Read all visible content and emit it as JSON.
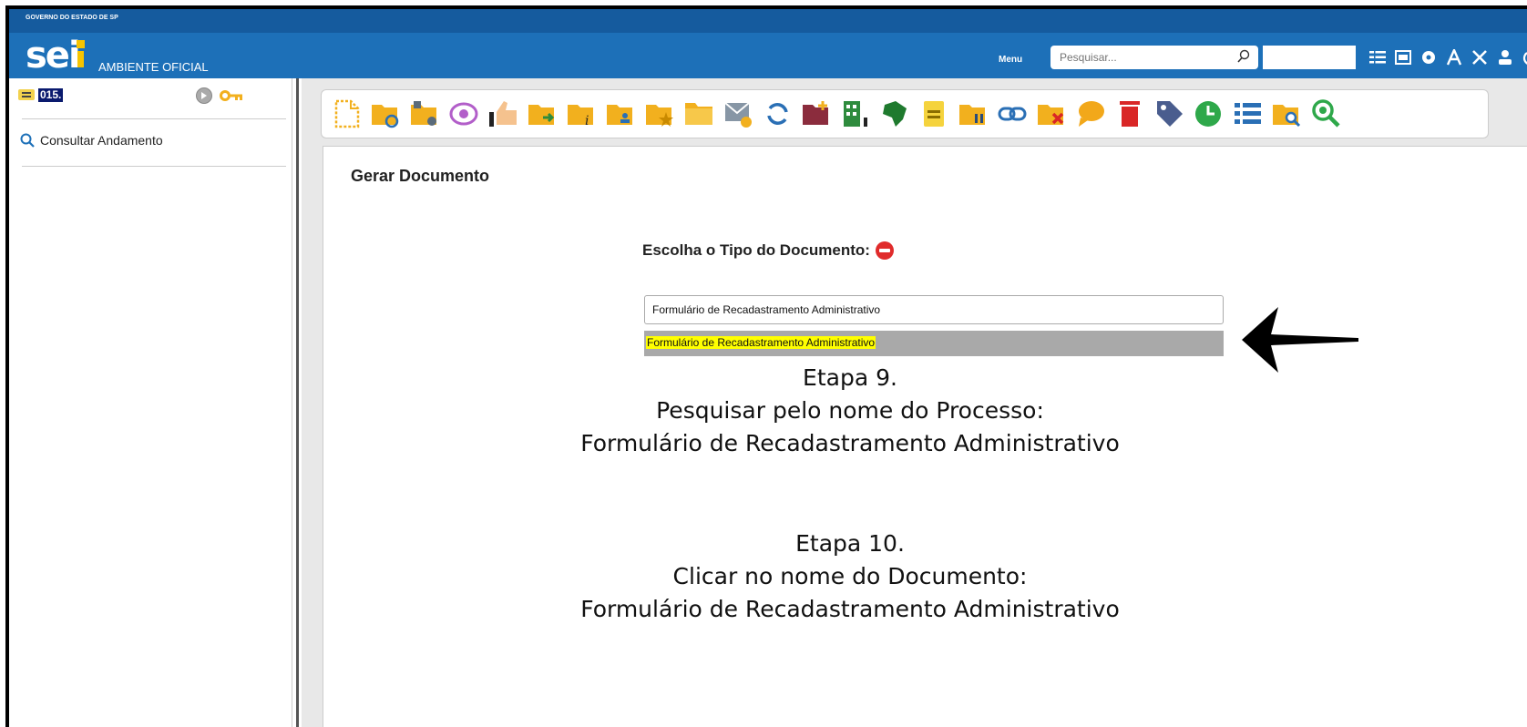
{
  "gov_bar": {
    "text": "GOVERNO DO ESTADO DE SP"
  },
  "header": {
    "logo_text": "sei",
    "ambiente": "AMBIENTE OFICIAL",
    "menu_label": "Menu",
    "search_placeholder": "Pesquisar..."
  },
  "sidebar": {
    "process_number": "015.",
    "consultar_label": "Consultar Andamento"
  },
  "main": {
    "title": "Gerar Documento",
    "escolha_label": "Escolha o Tipo do Documento:",
    "tipo_input_value": "Formulário de Recadastramento Administrativo",
    "suggestion": "Formulário de Recadastramento Administrativo",
    "etapa9": {
      "line1": "Etapa 9.",
      "line2": "Pesquisar pelo nome do Processo:",
      "line3": "Formulário de Recadastramento Administrativo"
    },
    "etapa10": {
      "line1": "Etapa 10.",
      "line2": "Clicar no nome do Documento:",
      "line3": "Formulário de Recadastramento Administrativo"
    }
  },
  "icons": {
    "toolbar": [
      "new-document-icon",
      "folder-sync-icon",
      "folder-settings-icon",
      "eye-icon",
      "thumbs-up-icon",
      "folder-send-icon",
      "folder-info-icon",
      "folder-user-icon",
      "folder-star-icon",
      "folder-icon",
      "mail-icon",
      "refresh-icon",
      "folder-add-icon",
      "building-icon",
      "brazil-map-icon",
      "note-icon",
      "folder-pause-icon",
      "link-icon",
      "folder-delete-icon",
      "comment-icon",
      "trash-icon",
      "tag-icon",
      "clock-icon",
      "list-icon",
      "folder-search-icon",
      "zoom-icon"
    ],
    "header": [
      "list-icon",
      "calendar-icon",
      "settings-icon",
      "font-size-icon",
      "tools-icon",
      "user-icon",
      "power-icon"
    ]
  },
  "colors": {
    "header": "#1d70b8",
    "gov_bar": "#155b9e",
    "folder": "#f2b01e",
    "highlight": "#ffff00",
    "suggestion_bg": "#a9a9a9"
  }
}
